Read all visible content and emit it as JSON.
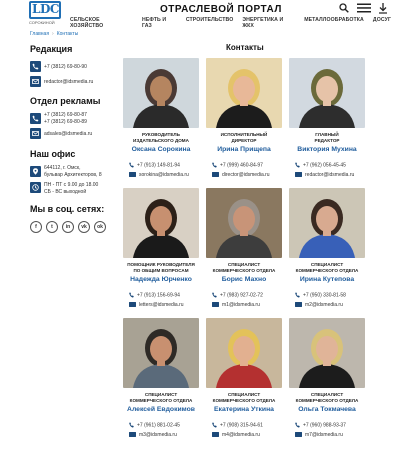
{
  "header": {
    "logo_text": "LDC",
    "logo_sub": "СОРОКИНОЙ",
    "portal_title": "ОТРАСЛЕВОЙ ПОРТАЛ",
    "nav": [
      "СЕЛЬСКОЕ ХОЗЯЙСТВО",
      "НЕФТЬ И ГАЗ",
      "СТРОИТЕЛЬСТВО",
      "ЭНЕРГЕТИКА И ЖКХ",
      "МЕТАЛЛООБРАБОТКА",
      "ДОСУГ"
    ]
  },
  "breadcrumb": {
    "home": "Главная",
    "current": "Контакты"
  },
  "sidebar": {
    "editorial_heading": "Редакция",
    "editorial_phone": "+7 (3812) 69-80-90",
    "editorial_email": "redactor@idsmedia.ru",
    "ads_heading": "Отдел рекламы",
    "ads_phone_1": "+7 (3812) 69-80-87",
    "ads_phone_2": "+7 (3812) 69-80-89",
    "ads_email": "adsales@idsmedia.ru",
    "office_heading": "Наш офис",
    "address_1": "644112, г. Омск,",
    "address_2": "бульвар Архитекторов, 8",
    "hours_1": "ПН - ПТ с 9.00 до 18.00",
    "hours_2": "СБ - ВС выходной",
    "social_heading": "Мы в соц. сетях:",
    "social_icons": [
      "f",
      "t",
      "in",
      "vk",
      "ok"
    ]
  },
  "main": {
    "title": "Контакты",
    "people": [
      {
        "role_1": "РУКОВОДИТЕЛЬ",
        "role_2": "ИЗДАТЕЛЬСКОГО ДОМА",
        "name": "Оксана Сорокина",
        "phone": "+7 (913) 149-81-94",
        "email": "sorokina@idsmedia.ru"
      },
      {
        "role_1": "ИСПОЛНИТЕЛЬНЫЙ",
        "role_2": "ДИРЕКТОР",
        "name": "Ирина Прищепа",
        "phone": "+7 (999) 460-84-97",
        "email": "director@idsmedia.ru"
      },
      {
        "role_1": "ГЛАВНЫЙ",
        "role_2": "РЕДАКТОР",
        "name": "Виктория Мухина",
        "phone": "+7 (962) 056-45-45",
        "email": "redactor@idsmedia.ru"
      },
      {
        "role_1": "ПОМОЩНИК РУКОВОДИТЕЛЯ",
        "role_2": "ПО ОБЩИМ ВОПРОСАМ",
        "name": "Надежда Юрченко",
        "phone": "+7 (913) 156-69-94",
        "email": "letters@idsmedia.ru"
      },
      {
        "role_1": "СПЕЦИАЛИСТ",
        "role_2": "КОММЕРЧЕСКОГО ОТДЕЛА",
        "name": "Борис Махно",
        "phone": "+7 (983) 927-02-72",
        "email": "m1@idsmedia.ru"
      },
      {
        "role_1": "СПЕЦИАЛИСТ",
        "role_2": "КОММЕРЧЕСКОГО ОТДЕЛА",
        "name": "Ирина Кутепова",
        "phone": "+7 (950) 330-81-58",
        "email": "m2@idsmedia.ru"
      },
      {
        "role_1": "СПЕЦИАЛИСТ",
        "role_2": "КОММЕРЧЕСКОГО ОТДЕЛА",
        "name": "Алексей Евдокимов",
        "phone": "+7 (961) 881-02-45",
        "email": "m3@idsmedia.ru"
      },
      {
        "role_1": "СПЕЦИАЛИСТ",
        "role_2": "КОММЕРЧЕСКОГО ОТДЕЛА",
        "name": "Екатерина Уткина",
        "phone": "+7 (908) 315-94-61",
        "email": "m4@idsmedia.ru"
      },
      {
        "role_1": "СПЕЦИАЛИСТ",
        "role_2": "КОММЕРЧЕСКОГО ОТДЕЛА",
        "name": "Ольга Токмачева",
        "phone": "+7 (960) 988-93-37",
        "email": "m7@idsmedia.ru"
      }
    ]
  },
  "colors": {
    "accent": "#1f5c9c",
    "icon_bg": "#1d4a7a"
  }
}
